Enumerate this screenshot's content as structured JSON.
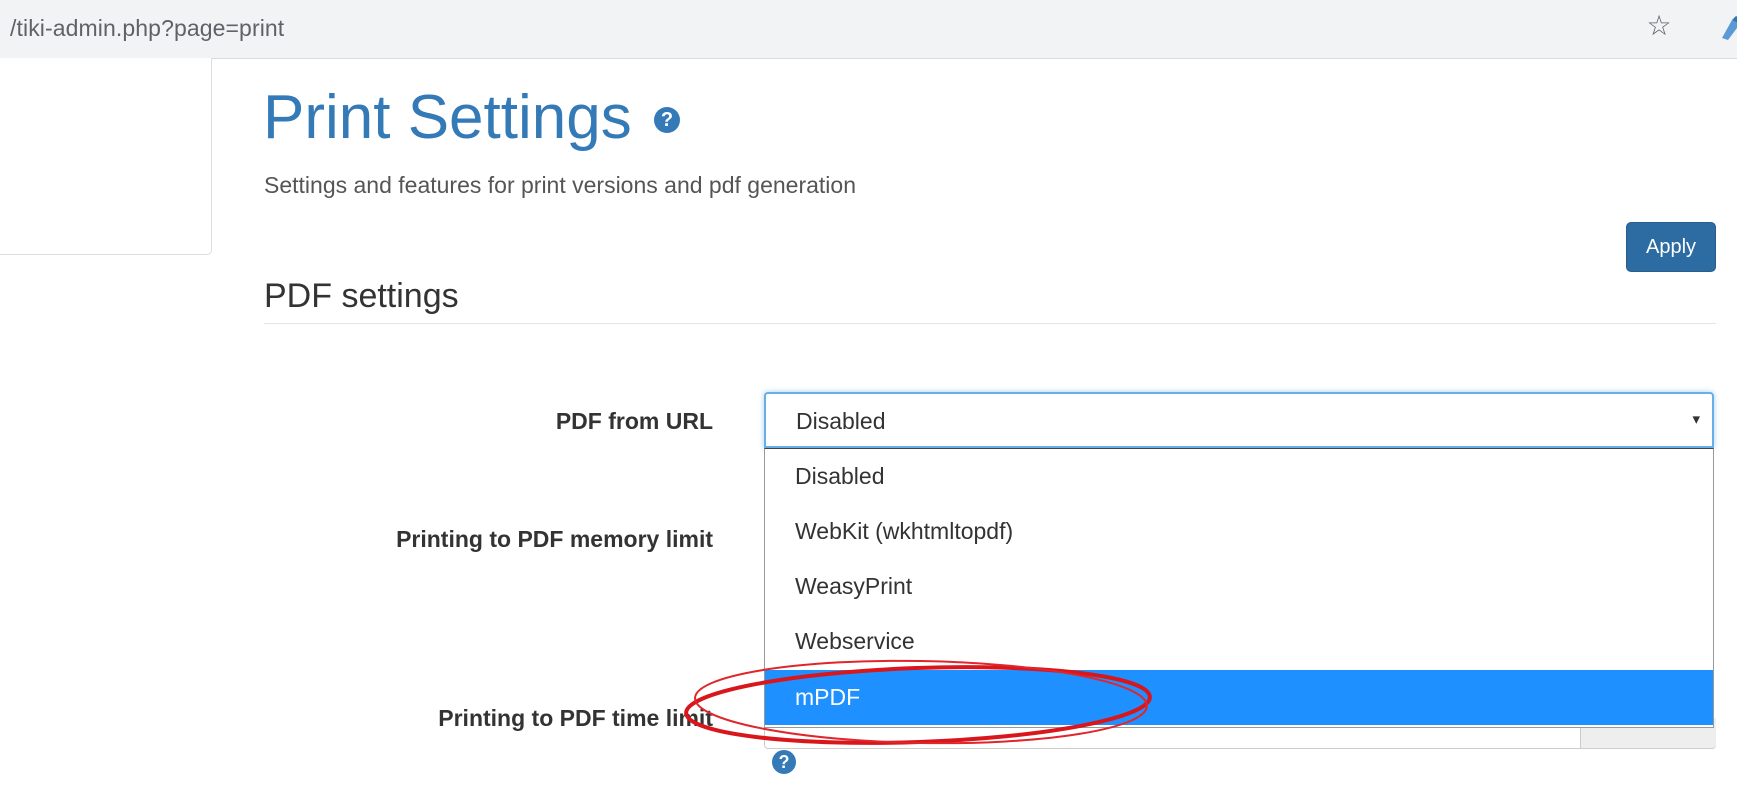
{
  "browser": {
    "url": "/tiki-admin.php?page=print",
    "bookmark_icon": "star-icon"
  },
  "header": {
    "title": "Print Settings",
    "help_icon": "question-circle-icon",
    "help_glyph": "?",
    "subtitle": "Settings and features for print versions and pdf generation"
  },
  "toolbar": {
    "apply_label": "Apply"
  },
  "section": {
    "title": "PDF settings"
  },
  "fields": {
    "pdf_from_url": {
      "label": "PDF from URL",
      "value": "Disabled",
      "caret": "▾",
      "options": [
        "Disabled",
        "WebKit (wkhtmltopdf)",
        "WeasyPrint",
        "Webservice",
        "mPDF"
      ],
      "highlighted_option": "mPDF"
    },
    "memory_limit": {
      "label": "Printing to PDF memory limit"
    },
    "time_limit": {
      "label": "Printing to PDF time limit",
      "help_glyph": "?"
    }
  },
  "colors": {
    "title_blue": "#337ab7",
    "apply_button": "#2d6ca2",
    "highlight": "#1e90ff",
    "annotation_red": "#d9161c"
  }
}
